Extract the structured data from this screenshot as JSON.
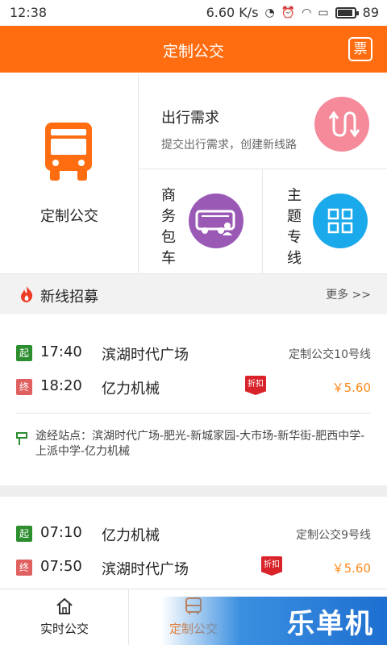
{
  "status_bar": {
    "time": "12:38",
    "network_speed": "6.60 K/s",
    "battery": "89"
  },
  "header": {
    "title": "定制公交",
    "ticket_label": "票"
  },
  "services": {
    "main": {
      "label": "定制公交",
      "icon": "bus-icon"
    },
    "travel_demand": {
      "title": "出行需求",
      "subtitle": "提交出行需求，创建新线路",
      "icon": "route-icon"
    },
    "charter": {
      "label_chars": [
        "商",
        "务",
        "包",
        "车"
      ],
      "icon": "charter-bus-icon"
    },
    "theme_line": {
      "label_chars": [
        "主",
        "题",
        "专",
        "线"
      ],
      "icon": "grid-icon"
    }
  },
  "section": {
    "title": "新线招募",
    "more": "更多 >>"
  },
  "routes": [
    {
      "start_tag": "起",
      "start_time": "17:40",
      "start_stop": "滨湖时代广场",
      "line_name": "定制公交10号线",
      "end_tag": "终",
      "end_time": "18:20",
      "end_stop": "亿力机械",
      "discount": "折扣",
      "price": "￥5.60",
      "via": "途经站点：滨湖时代广场-肥光-新城家园-大市场-新华街-肥西中学-上派中学-亿力机械"
    },
    {
      "start_tag": "起",
      "start_time": "07:10",
      "start_stop": "亿力机械",
      "line_name": "定制公交9号线",
      "end_tag": "终",
      "end_time": "07:50",
      "end_stop": "滨湖时代广场",
      "discount": "折扣",
      "price": "￥5.60"
    }
  ],
  "tabbar": {
    "tabs": [
      {
        "label": "实时公交",
        "icon": "home-icon"
      },
      {
        "label": "定制公交",
        "icon": "bus-icon",
        "active": true
      }
    ]
  },
  "watermark": "乐单机",
  "colors": {
    "brand_orange": "#ff6d10",
    "price_orange": "#ff8a1a",
    "start_green": "#2d8e2f",
    "end_red": "#e06060",
    "discount_red": "#d8232a"
  }
}
